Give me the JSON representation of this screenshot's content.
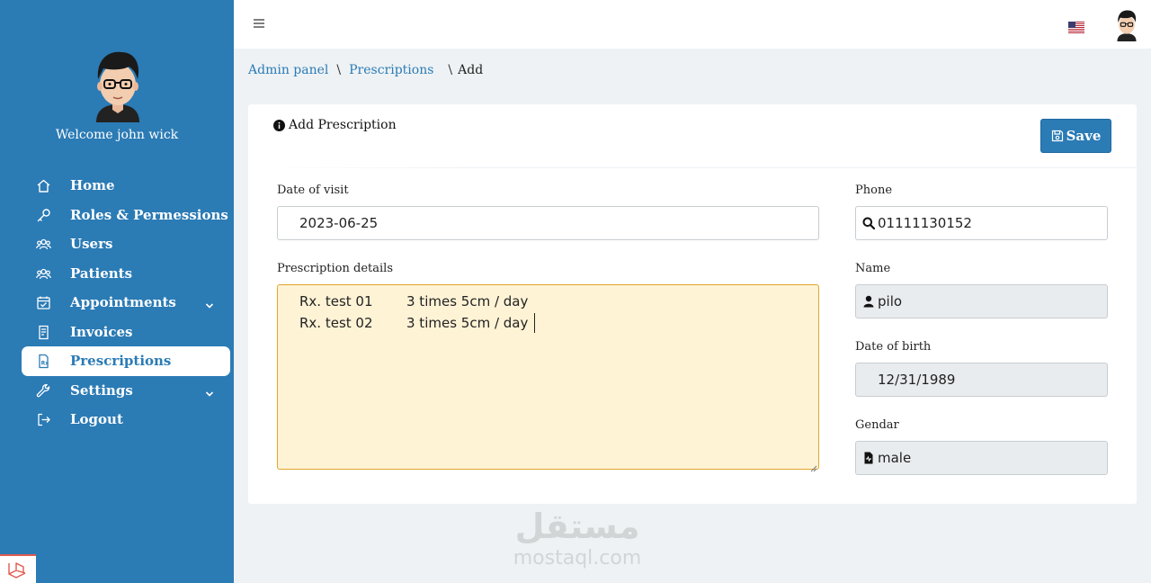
{
  "sidebar": {
    "welcome": "Welcome john wick",
    "items": [
      {
        "label": "Home",
        "icon": "home-icon"
      },
      {
        "label": "Roles & Permessions",
        "icon": "key-icon"
      },
      {
        "label": "Users",
        "icon": "users-icon"
      },
      {
        "label": "Patients",
        "icon": "patients-icon"
      },
      {
        "label": "Appointments",
        "icon": "calendar-check-icon",
        "has_submenu": true
      },
      {
        "label": "Invoices",
        "icon": "invoice-icon"
      },
      {
        "label": "Prescriptions",
        "icon": "prescription-icon",
        "active": true
      },
      {
        "label": "Settings",
        "icon": "wrench-icon",
        "has_submenu": true
      },
      {
        "label": "Logout",
        "icon": "logout-icon"
      }
    ]
  },
  "breadcrumb": {
    "items": [
      "Admin panel",
      "Prescriptions"
    ],
    "current": "Add",
    "separator": "\\"
  },
  "card": {
    "title": "Add Prescription",
    "save_label": "Save"
  },
  "form": {
    "date_of_visit": {
      "label": "Date of visit",
      "value": "2023-06-25"
    },
    "prescription_details": {
      "label": "Prescription details",
      "lines": [
        {
          "name": "Rx. test 01",
          "dose": "3 times 5cm / day"
        },
        {
          "name": "Rx. test 02",
          "dose": "3 times 5cm / day"
        }
      ]
    },
    "phone": {
      "label": "Phone",
      "value": "01111130152"
    },
    "name": {
      "label": "Name",
      "value": "pilo"
    },
    "date_of_birth": {
      "label": "Date of birth",
      "value": "12/31/1989"
    },
    "gender": {
      "label": "Gendar",
      "value": "male"
    }
  },
  "watermark": {
    "arabic": "مستقل",
    "latin": "mostaql.com"
  },
  "colors": {
    "primary": "#2b7bb5",
    "page_bg": "#eef2f4",
    "textarea_bg": "#fff3d6",
    "textarea_border": "#e0a72c",
    "readonly_bg": "#e9ecef"
  }
}
